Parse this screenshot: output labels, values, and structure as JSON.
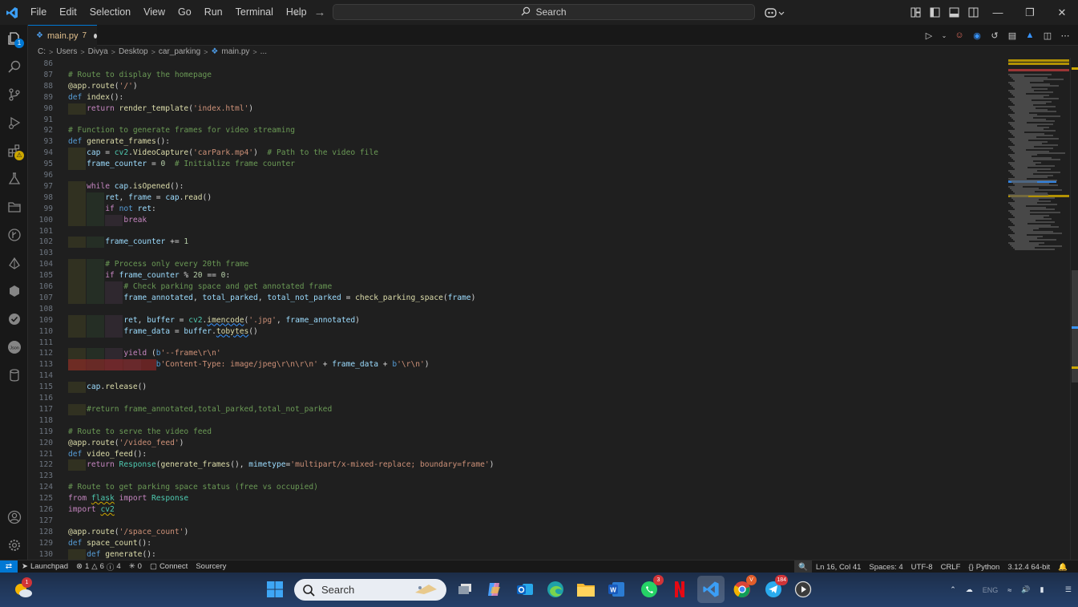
{
  "menu": [
    "File",
    "Edit",
    "Selection",
    "View",
    "Go",
    "Run",
    "Terminal",
    "Help"
  ],
  "search": {
    "label": "Search"
  },
  "tab": {
    "label": "main.py",
    "problems": "7"
  },
  "breadcrumb": [
    "C:",
    "Users",
    "Divya",
    "Desktop",
    "car_parking",
    "main.py",
    "..."
  ],
  "code_lines": [
    {
      "n": "86",
      "html": ""
    },
    {
      "n": "87",
      "html": "<span class='c'># Route to display the homepage</span>"
    },
    {
      "n": "88",
      "html": "<span class='d'>@app</span>.<span class='f'>route</span>(<span class='s'>'/'</span>)"
    },
    {
      "n": "89",
      "html": "<span class='k'>def</span> <span class='f'>index</span>():"
    },
    {
      "n": "90",
      "html": "    <span class='kc'>return</span> <span class='f'>render_template</span>(<span class='s'>'index.html'</span>)"
    },
    {
      "n": "91",
      "html": ""
    },
    {
      "n": "92",
      "html": "<span class='c'># Function to generate frames for video streaming</span>"
    },
    {
      "n": "93",
      "html": "<span class='k'>def</span> <span class='f'>generate_frames</span>():"
    },
    {
      "n": "94",
      "html": "    <span class='v'>cap</span> = <span class='t'>cv2</span>.<span class='f'>VideoCapture</span>(<span class='s'>'carPark.mp4'</span>)  <span class='c'># Path to the video file</span>"
    },
    {
      "n": "95",
      "html": "    <span class='v'>frame_counter</span> = <span class='n'>0</span>  <span class='c'># Initialize frame counter</span>"
    },
    {
      "n": "96",
      "html": ""
    },
    {
      "n": "97",
      "html": "    <span class='kc'>while</span> <span class='v'>cap</span>.<span class='f'>isOpened</span>():"
    },
    {
      "n": "98",
      "html": "        <span class='v'>ret</span>, <span class='v'>frame</span> = <span class='v'>cap</span>.<span class='f'>read</span>()"
    },
    {
      "n": "99",
      "html": "        <span class='kc'>if</span> <span class='k'>not</span> <span class='v'>ret</span>:"
    },
    {
      "n": "100",
      "html": "            <span class='kc'>break</span>"
    },
    {
      "n": "101",
      "html": ""
    },
    {
      "n": "102",
      "html": "        <span class='v'>frame_counter</span> += <span class='n'>1</span>"
    },
    {
      "n": "103",
      "html": ""
    },
    {
      "n": "104",
      "html": "        <span class='c'># Process only every 20th frame</span>"
    },
    {
      "n": "105",
      "html": "        <span class='kc'>if</span> <span class='v'>frame_counter</span> % <span class='n'>20</span> == <span class='n'>0</span>:"
    },
    {
      "n": "106",
      "html": "            <span class='c'># Check parking space and get annotated frame</span>"
    },
    {
      "n": "107",
      "html": "            <span class='v'>frame_annotated</span>, <span class='v'>total_parked</span>, <span class='v'>total_not_parked</span> = <span class='f'>check_parking_space</span>(<span class='v'>frame</span>)"
    },
    {
      "n": "108",
      "html": ""
    },
    {
      "n": "109",
      "html": "            <span class='v'>ret</span>, <span class='v'>buffer</span> = <span class='t'>cv2</span>.<span class='f sqb'>imencode</span>(<span class='s'>'.jpg'</span>, <span class='v'>frame_annotated</span>)"
    },
    {
      "n": "110",
      "html": "            <span class='v'>frame_data</span> = <span class='v'>buffer</span>.<span class='f sqb'>tobytes</span>()"
    },
    {
      "n": "111",
      "html": ""
    },
    {
      "n": "112",
      "html": "            <span class='kc'>yield</span> (<span class='k'>b</span><span class='s'>'--frame\\r\\n'</span>"
    },
    {
      "n": "113",
      "html": "                   <span class='k'>b</span><span class='s'>'Content-Type: image/jpeg\\r\\n\\r\\n'</span> + <span class='v'>frame_data</span> + <span class='k'>b</span><span class='s'>'\\r\\n'</span>)"
    },
    {
      "n": "114",
      "html": ""
    },
    {
      "n": "115",
      "html": "    <span class='v'>cap</span>.<span class='f'>release</span>()"
    },
    {
      "n": "116",
      "html": ""
    },
    {
      "n": "117",
      "html": "    <span class='c'>#return frame_annotated,total_parked,total_not_parked</span>"
    },
    {
      "n": "118",
      "html": ""
    },
    {
      "n": "119",
      "html": "<span class='c'># Route to serve the video feed</span>"
    },
    {
      "n": "120",
      "html": "<span class='d'>@app</span>.<span class='f'>route</span>(<span class='s'>'/video_feed'</span>)"
    },
    {
      "n": "121",
      "html": "<span class='k'>def</span> <span class='f'>video_feed</span>():"
    },
    {
      "n": "122",
      "html": "    <span class='kc'>return</span> <span class='t'>Response</span>(<span class='f'>generate_frames</span>(), <span class='v'>mimetype</span>=<span class='s'>'multipart/x-mixed-replace; boundary=frame'</span>)"
    },
    {
      "n": "123",
      "html": ""
    },
    {
      "n": "124",
      "html": "<span class='c'># Route to get parking space status (free vs occupied)</span>"
    },
    {
      "n": "125",
      "html": "<span class='kc'>from</span> <span class='t sq'>flask</span> <span class='kc'>import</span> <span class='t'>Response</span>"
    },
    {
      "n": "126",
      "html": "<span class='kc'>import</span> <span class='t sq'>cv2</span>"
    },
    {
      "n": "127",
      "html": ""
    },
    {
      "n": "128",
      "html": "<span class='d'>@app</span>.<span class='f'>route</span>(<span class='s'>'/space_count'</span>)"
    },
    {
      "n": "129",
      "html": "<span class='k'>def</span> <span class='f'>space_count</span>():"
    },
    {
      "n": "130",
      "html": "    <span class='k'>def</span> <span class='f'>generate</span>():"
    }
  ],
  "status": {
    "launchpad": "Launchpad",
    "errors": "1",
    "warnings": "6",
    "infos": "4",
    "ports": "0",
    "connect": "Connect",
    "sourcery": "Sourcery",
    "position": "Ln 16, Col 41",
    "spaces": "Spaces: 4",
    "encoding": "UTF-8",
    "eol": "CRLF",
    "language": "Python",
    "interpreter": "3.12.4 64-bit"
  },
  "taskbar": {
    "search": "Search",
    "weather_badge": "1",
    "whatsapp_badge": "3",
    "telegram_badge": "184"
  },
  "icons": {
    "activity": [
      "files-icon",
      "search-icon",
      "source-control-icon",
      "run-debug-icon",
      "extensions-icon",
      "testing-icon",
      "folder-icon",
      "git-graph-icon",
      "deploy-icon",
      "hexagon-icon",
      "check-circle-icon",
      "json-icon",
      "database-icon",
      "account-icon",
      "settings-icon"
    ]
  },
  "colors": {
    "accent": "#0078d4",
    "background": "#1f1f1f",
    "statusbar": "#181818"
  }
}
